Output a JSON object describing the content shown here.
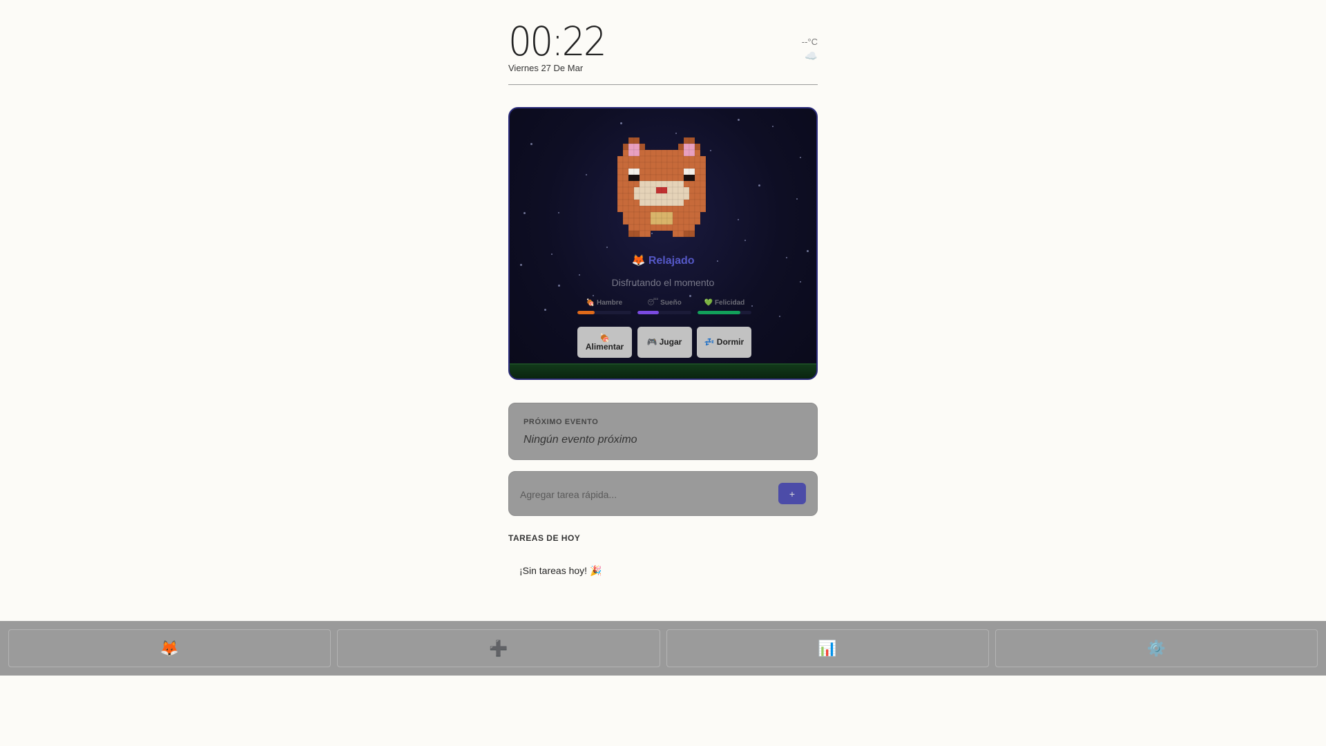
{
  "header": {
    "time": "00:22",
    "date": "Viernes 27 De Mar",
    "temperature": "--°C",
    "weather_icon": "☁️"
  },
  "pet": {
    "status": "🦊 Relajado",
    "subtitle": "Disfrutando el momento",
    "colors": {
      "fur": "#c76a3a",
      "fur_dark": "#a8542a",
      "muzzle": "#e5d3b8",
      "ear_inner": "#e8a0c0",
      "belly": "#d9b46a",
      "mouth": "#c03030"
    },
    "stats": [
      {
        "icon": "🍖",
        "label": "Hambre",
        "value": 0.32,
        "color": "#e06a1a"
      },
      {
        "icon": "😴",
        "label": "Sueño",
        "value": 0.4,
        "color": "#7a4ae0"
      },
      {
        "icon": "💚",
        "label": "Felicidad",
        "value": 0.8,
        "color": "#12a05a"
      }
    ],
    "actions": [
      {
        "icon": "🍖",
        "label": "Alimentar"
      },
      {
        "icon": "🎮",
        "label": "Jugar"
      },
      {
        "icon": "💤",
        "label": "Dormir"
      }
    ]
  },
  "event": {
    "label": "PRÓXIMO EVENTO",
    "value": "Ningún evento próximo"
  },
  "quick_task": {
    "placeholder": "Agregar tarea rápida...",
    "add_label": "+"
  },
  "tasks": {
    "title": "TAREAS DE HOY",
    "empty": "¡Sin tareas hoy! 🎉"
  },
  "nav": [
    {
      "icon": "🦊",
      "name": "pet"
    },
    {
      "icon": "➕",
      "name": "add"
    },
    {
      "icon": "📊",
      "name": "stats"
    },
    {
      "icon": "⚙️",
      "name": "settings"
    }
  ]
}
